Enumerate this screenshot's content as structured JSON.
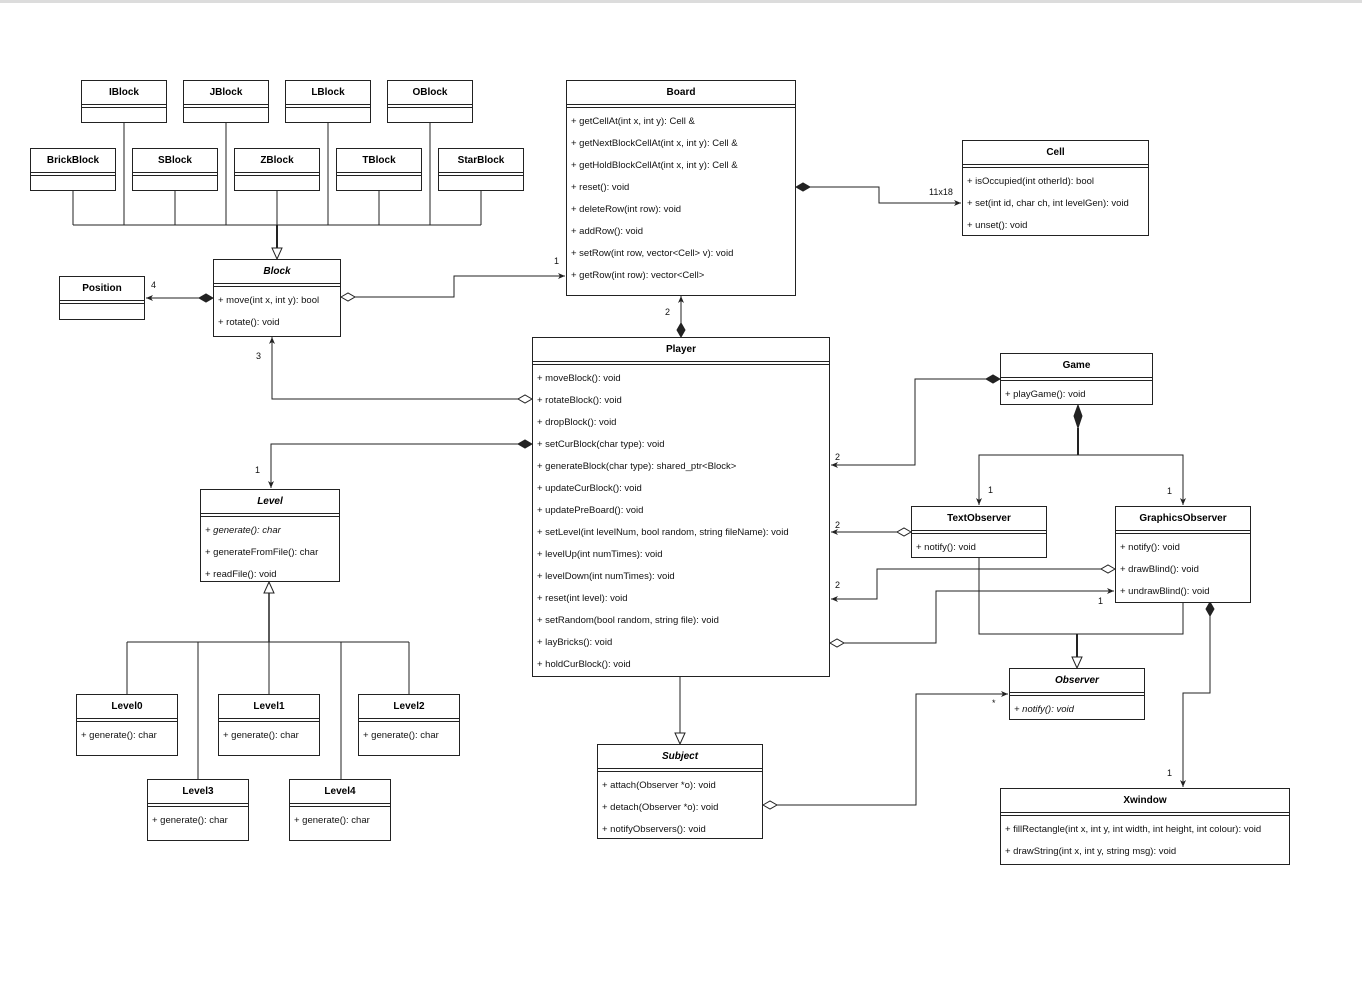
{
  "colors": {
    "line": "#222222",
    "background": "#ffffff"
  },
  "classes": [
    {
      "name": "IBlock",
      "abstract": false,
      "methods": []
    },
    {
      "name": "JBlock",
      "abstract": false,
      "methods": []
    },
    {
      "name": "LBlock",
      "abstract": false,
      "methods": []
    },
    {
      "name": "OBlock",
      "abstract": false,
      "methods": []
    },
    {
      "name": "BrickBlock",
      "abstract": false,
      "methods": []
    },
    {
      "name": "SBlock",
      "abstract": false,
      "methods": []
    },
    {
      "name": "ZBlock",
      "abstract": false,
      "methods": []
    },
    {
      "name": "TBlock",
      "abstract": false,
      "methods": []
    },
    {
      "name": "StarBlock",
      "abstract": false,
      "methods": []
    },
    {
      "name": "Block",
      "abstract": true,
      "methods": [
        {
          "text": "+ move(int x, int y): bool"
        },
        {
          "text": "+ rotate(): void"
        }
      ]
    },
    {
      "name": "Position",
      "abstract": false,
      "methods": []
    },
    {
      "name": "Board",
      "abstract": false,
      "methods": [
        {
          "text": "+ getCellAt(int x, int y): Cell &"
        },
        {
          "text": "+ getNextBlockCellAt(int x, int y): Cell &"
        },
        {
          "text": "+ getHoldBlockCellAt(int x, int y): Cell &"
        },
        {
          "text": "+ reset(): void"
        },
        {
          "text": "+ deleteRow(int row): void"
        },
        {
          "text": "+ addRow(): void"
        },
        {
          "text": "+ setRow(int row, vector<Cell> v): void"
        },
        {
          "text": "+ getRow(int row): vector<Cell>"
        }
      ]
    },
    {
      "name": "Cell",
      "abstract": false,
      "methods": [
        {
          "text": "+ isOccupied(int otherId): bool"
        },
        {
          "text": "+ set(int id, char ch, int levelGen): void"
        },
        {
          "text": "+ unset(): void"
        }
      ]
    },
    {
      "name": "Player",
      "abstract": false,
      "methods": [
        {
          "text": "+ moveBlock(): void"
        },
        {
          "text": "+ rotateBlock(): void"
        },
        {
          "text": "+ dropBlock(): void"
        },
        {
          "text": "+ setCurBlock(char type): void"
        },
        {
          "text": "+ generateBlock(char type): shared_ptr<Block>"
        },
        {
          "text": "+ updateCurBlock(): void"
        },
        {
          "text": "+ updatePreBoard(): void"
        },
        {
          "text": "+ setLevel(int levelNum, bool random, string fileName): void"
        },
        {
          "text": "+ levelUp(int numTimes): void"
        },
        {
          "text": "+ levelDown(int numTimes): void"
        },
        {
          "text": "+ reset(int level): void"
        },
        {
          "text": "+ setRandom(bool random, string file): void"
        },
        {
          "text": "+ layBricks(): void"
        },
        {
          "text": "+ holdCurBlock(): void"
        }
      ]
    },
    {
      "name": "Game",
      "abstract": false,
      "methods": [
        {
          "text": "+ playGame(): void"
        }
      ]
    },
    {
      "name": "TextObserver",
      "abstract": false,
      "methods": [
        {
          "text": "+ notify(): void"
        }
      ]
    },
    {
      "name": "GraphicsObserver",
      "abstract": false,
      "methods": [
        {
          "text": "+ notify(): void"
        },
        {
          "text": "+ drawBlind(): void"
        },
        {
          "text": "+ undrawBlind(): void"
        }
      ]
    },
    {
      "name": "Observer",
      "abstract": true,
      "methods": [
        {
          "text": "+ notify(): void",
          "italic": true
        }
      ]
    },
    {
      "name": "Xwindow",
      "abstract": false,
      "methods": [
        {
          "text": "+ fillRectangle(int x, int y, int width, int height, int colour): void"
        },
        {
          "text": "+ drawString(int x, int y, string msg): void"
        }
      ]
    },
    {
      "name": "Subject",
      "abstract": true,
      "methods": [
        {
          "text": "+ attach(Observer *o): void"
        },
        {
          "text": "+ detach(Observer *o): void"
        },
        {
          "text": "+ notifyObservers(): void"
        }
      ]
    },
    {
      "name": "Level",
      "abstract": true,
      "methods": [
        {
          "text": "+ generate(): char",
          "italic": true
        },
        {
          "text": "+ generateFromFile(): char"
        },
        {
          "text": "+ readFile(): void"
        }
      ]
    },
    {
      "name": "Level0",
      "abstract": false,
      "methods": [
        {
          "text": "+ generate(): char"
        }
      ]
    },
    {
      "name": "Level1",
      "abstract": false,
      "methods": [
        {
          "text": "+ generate(): char"
        }
      ]
    },
    {
      "name": "Level2",
      "abstract": false,
      "methods": [
        {
          "text": "+ generate(): char"
        }
      ]
    },
    {
      "name": "Level3",
      "abstract": false,
      "methods": [
        {
          "text": "+ generate(): char"
        }
      ]
    },
    {
      "name": "Level4",
      "abstract": false,
      "methods": [
        {
          "text": "+ generate(): char"
        }
      ]
    }
  ],
  "multiplicities": [
    {
      "text": "4",
      "relation": "Block-Position"
    },
    {
      "text": "1",
      "relation": "Block-Board"
    },
    {
      "text": "11x18",
      "relation": "Board-Cell"
    },
    {
      "text": "2",
      "relation": "Player-Board"
    },
    {
      "text": "3",
      "relation": "Player-Block"
    },
    {
      "text": "1",
      "relation": "Player-Level"
    },
    {
      "text": "2",
      "relation": "Game-Player"
    },
    {
      "text": "1",
      "relation": "Game-TextObserver"
    },
    {
      "text": "1",
      "relation": "Game-GraphicsObserver"
    },
    {
      "text": "2",
      "relation": "TextObserver-Player"
    },
    {
      "text": "2",
      "relation": "GraphicsObserver-Player"
    },
    {
      "text": "1",
      "relation": "Player-GraphicsObserver"
    },
    {
      "text": "1",
      "relation": "GraphicsObserver-Xwindow"
    },
    {
      "text": "*",
      "relation": "Subject-Observer"
    }
  ]
}
